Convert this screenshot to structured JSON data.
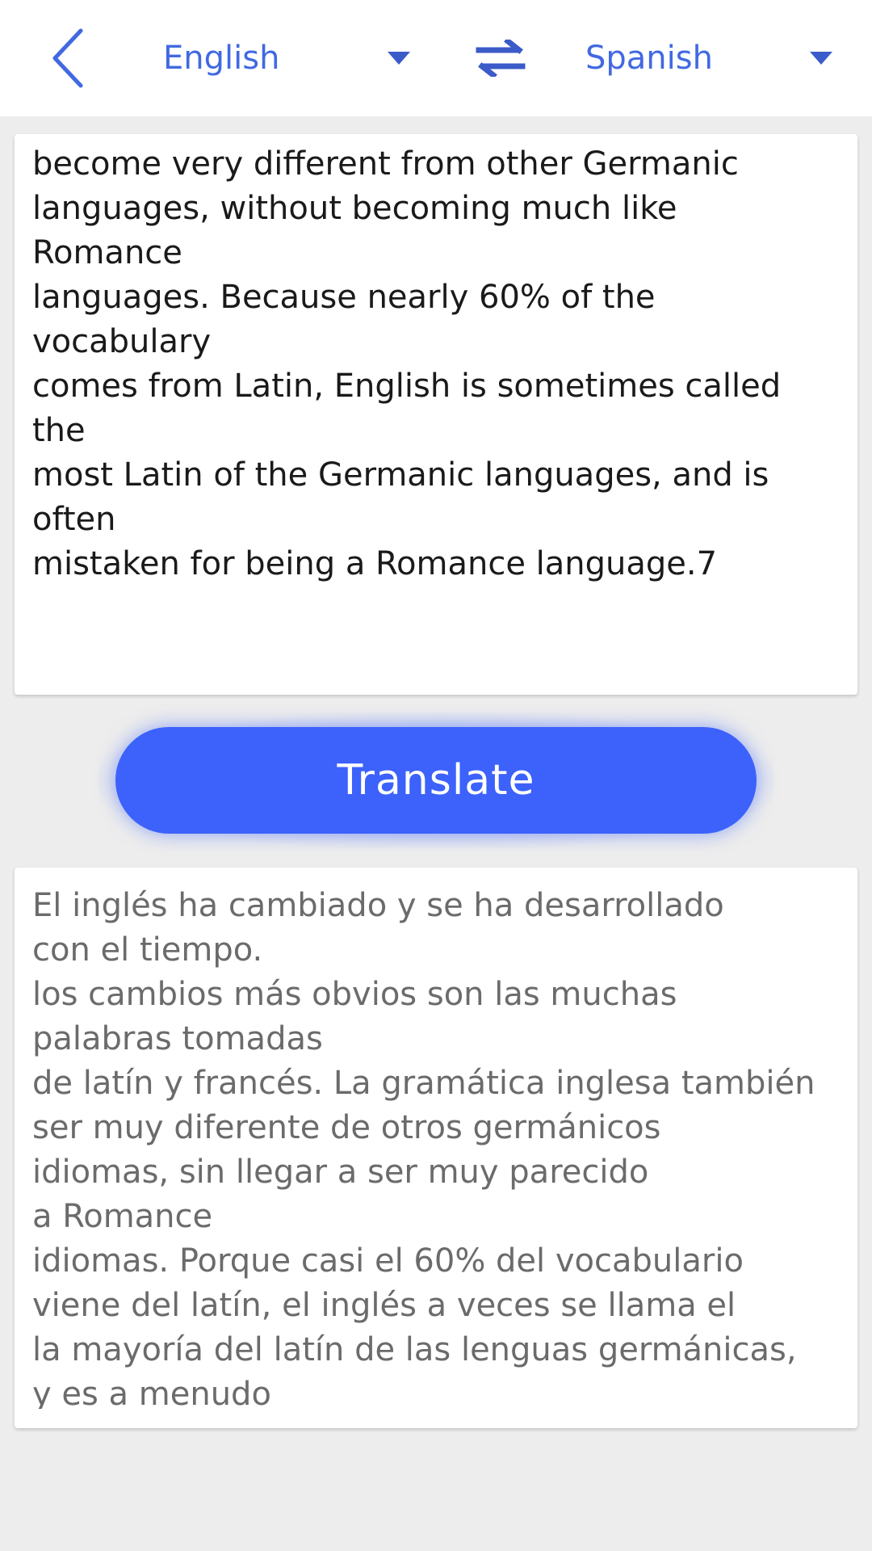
{
  "header": {
    "source_language": "English",
    "target_language": "Spanish"
  },
  "icons": {
    "back": "chevron-left-icon",
    "swap": "swap-arrows-icon",
    "dropdown": "caret-down-icon"
  },
  "source": {
    "text": "become very different from other Germanic\nlanguages, without becoming much like\nRomance\nlanguages. Because nearly 60% of the\nvocabulary\ncomes from Latin, English is sometimes called\nthe\nmost Latin of the Germanic languages, and is\noften\nmistaken for being a Romance language.7"
  },
  "translate_button": {
    "label": "Translate"
  },
  "result": {
    "text": "El inglés ha cambiado y se ha desarrollado\ncon el tiempo.\nlos cambios más obvios son las muchas\npalabras tomadas\nde latín y francés. La gramática inglesa también\nser muy diferente de otros germánicos\nidiomas, sin llegar a ser muy parecido\na Romance\nidiomas. Porque casi el 60% del vocabulario\nviene del latín, el inglés a veces se llama el\nla mayoría del latín de las lenguas germánicas,\ny es a menudo"
  },
  "colors": {
    "accent": "#4169e1",
    "button": "#3c62fb",
    "background": "#ededed",
    "card": "#ffffff"
  }
}
